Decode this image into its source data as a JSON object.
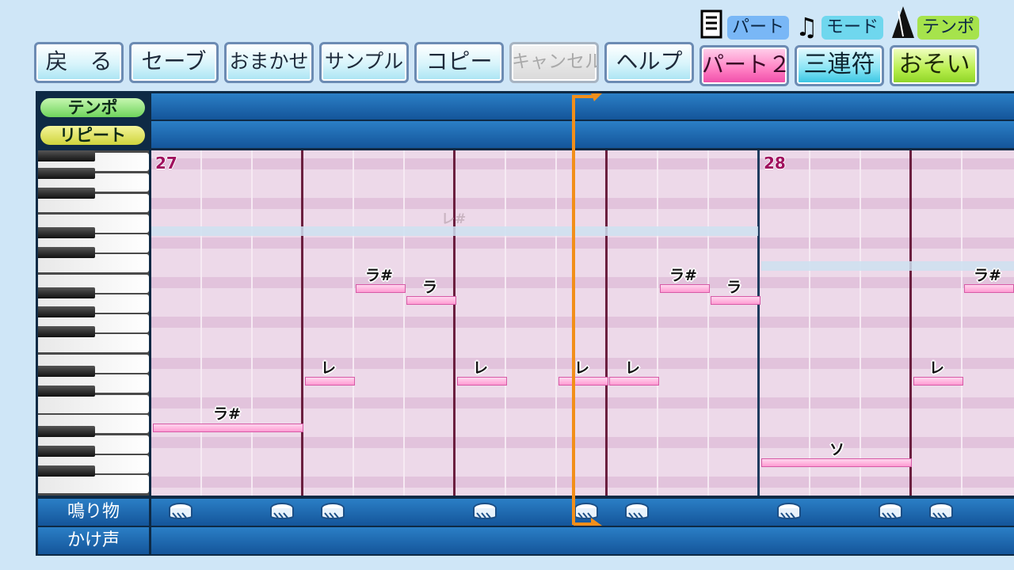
{
  "toolbar": {
    "buttons": [
      {
        "label": "戻　る"
      },
      {
        "label": "セーブ"
      },
      {
        "label": "おまかせ"
      },
      {
        "label": "サンプル"
      },
      {
        "label": "コピー"
      },
      {
        "label": "キャンセル"
      },
      {
        "label": "ヘルプ"
      }
    ]
  },
  "mode_tags": {
    "part": {
      "label": "パート",
      "value": "パート２",
      "color": "#ff7fc3"
    },
    "mode": {
      "label": "モード",
      "value": "三連符",
      "color": "#84e3f4"
    },
    "tempo": {
      "label": "テンポ",
      "value": "おそい",
      "color": "#b7ee4c"
    }
  },
  "rows": {
    "tempo": "テンポ",
    "repeat": "リピート",
    "instrument": "鳴り物",
    "call": "かけ声"
  },
  "measures": [
    "27",
    "28"
  ],
  "notes": [
    {
      "label": "ラ#"
    },
    {
      "label": "レ"
    },
    {
      "label": "ラ#"
    },
    {
      "label": "ラ"
    },
    {
      "label": "レ"
    },
    {
      "label": "レ"
    },
    {
      "label": "レ"
    },
    {
      "label": "ラ#"
    },
    {
      "label": "ラ"
    },
    {
      "label": "ソ"
    },
    {
      "label": "レ"
    },
    {
      "label": "ラ#"
    }
  ],
  "ghost_note": {
    "label": "レ#"
  }
}
